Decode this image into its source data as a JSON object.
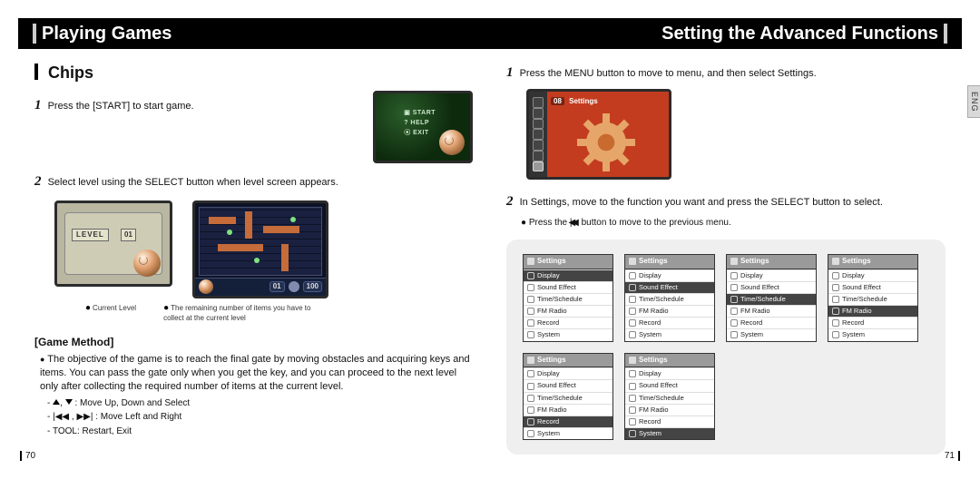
{
  "header": {
    "left_title": "Playing Games",
    "right_title": "Setting the Advanced Functions"
  },
  "side_tab": "ENG",
  "left_page": {
    "section_title": "Chips",
    "step1": "Press the [START] to start game.",
    "step2": "Select level using the SELECT button when level screen appears.",
    "start_menu": {
      "start": "START",
      "help": "HELP",
      "exit": "EXIT"
    },
    "level_screen": {
      "label": "LEVEL",
      "number": "01"
    },
    "maze_hud": {
      "level_display": "01",
      "remaining": "100"
    },
    "callout_level": "Current Level",
    "callout_remaining": "The remaining number of items you have to collect at the current level",
    "method_heading": "[Game Method]",
    "method_body": "The objective of the game is to reach the final gate by moving obstacles and acquiring keys and items. You can pass the gate only when you get the key, and you can proceed to the next level only after collecting the required number of items at the current level.",
    "hints": {
      "updown": ": Move Up, Down and Select",
      "prevnext": ": Move Left and Right",
      "tool": "TOOL: Restart, Exit"
    },
    "page_number": "70"
  },
  "right_page": {
    "step1": "Press the MENU button to move to menu, and then select Settings.",
    "settings_device": {
      "index": "08",
      "title": "Settings"
    },
    "step2": "In Settings, move to the function you want and press the SELECT button to select.",
    "step2_sub_pre": "Press the ",
    "step2_sub_post": " button to move to the previous menu.",
    "settings_items": [
      "Display",
      "Sound Effect",
      "Time/Schedule",
      "FM Radio",
      "Record",
      "System"
    ],
    "panels": [
      {
        "title": "Settings",
        "selected": 0
      },
      {
        "title": "Settings",
        "selected": 1
      },
      {
        "title": "Settings",
        "selected": 2
      },
      {
        "title": "Settings",
        "selected": 3
      },
      {
        "title": "Settings",
        "selected": 4
      },
      {
        "title": "Settings",
        "selected": 5
      }
    ],
    "page_number": "71"
  }
}
